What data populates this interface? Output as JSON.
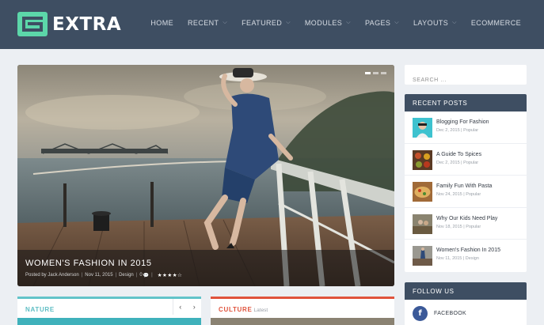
{
  "brand": {
    "name": "EXTRA",
    "accent": "#5cd6a9",
    "header_bg": "#3e4e62"
  },
  "nav": {
    "items": [
      {
        "label": "HOME",
        "dropdown": false
      },
      {
        "label": "RECENT",
        "dropdown": true
      },
      {
        "label": "FEATURED",
        "dropdown": true
      },
      {
        "label": "MODULES",
        "dropdown": true
      },
      {
        "label": "PAGES",
        "dropdown": true
      },
      {
        "label": "LAYOUTS",
        "dropdown": true
      },
      {
        "label": "ECOMMERCE",
        "dropdown": false
      }
    ]
  },
  "hero": {
    "title": "WOMEN'S FASHION IN 2015",
    "author_prefix": "Posted by",
    "author": "Jack Anderson",
    "date": "Nov 11, 2015",
    "category": "Design",
    "comments": "0",
    "rating": "★★★★☆"
  },
  "search": {
    "placeholder": "SEARCH ..."
  },
  "recent_posts": {
    "heading": "RECENT POSTS",
    "posts": [
      {
        "title": "Blogging For Fashion",
        "meta": "Dec 2, 2015 | Popular"
      },
      {
        "title": "A Guide To Spices",
        "meta": "Dec 2, 2015 | Popular"
      },
      {
        "title": "Family Fun With Pasta",
        "meta": "Nov 24, 2015 | Popular"
      },
      {
        "title": "Why Our Kids Need Play",
        "meta": "Nov 18, 2015 | Popular"
      },
      {
        "title": "Women's Fashion In 2015",
        "meta": "Nov 11, 2015 | Design"
      }
    ]
  },
  "follow": {
    "heading": "FOLLOW US",
    "facebook_label": "FACEBOOK",
    "facebook_glyph": "f"
  },
  "cards": {
    "nature": {
      "title": "NATURE",
      "prev": "‹",
      "next": "›",
      "color": "#62c3c9"
    },
    "culture": {
      "title": "CULTURE",
      "subtitle": "Latest",
      "color": "#e0533c"
    }
  }
}
